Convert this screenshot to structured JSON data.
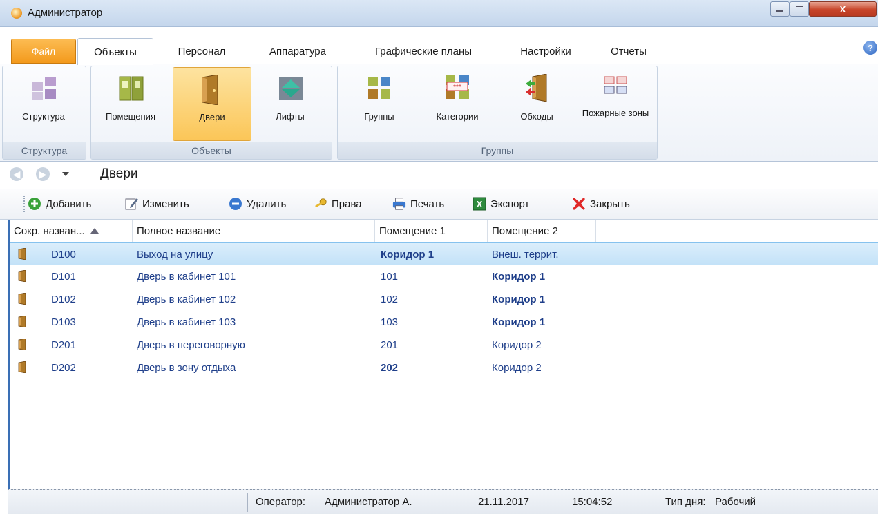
{
  "window": {
    "title": "Администратор",
    "controls": {
      "minimize": "_",
      "maximize": "□",
      "close": "X"
    }
  },
  "ribbon_tabs": {
    "file": "Файл",
    "tabs": [
      "Объекты",
      "Персонал",
      "Аппаратура",
      "Графические планы",
      "Настройки",
      "Отчеты"
    ],
    "active": "Объекты"
  },
  "ribbon": {
    "groups": [
      {
        "label": "Структура",
        "buttons": [
          {
            "label": "Структура",
            "icon": "structure-icon"
          }
        ]
      },
      {
        "label": "Объекты",
        "buttons": [
          {
            "label": "Помещения",
            "icon": "rooms-icon"
          },
          {
            "label": "Двери",
            "icon": "door-icon",
            "selected": true
          },
          {
            "label": "Лифты",
            "icon": "elevator-icon"
          }
        ]
      },
      {
        "label": "Группы",
        "buttons": [
          {
            "label": "Группы",
            "icon": "groups-icon"
          },
          {
            "label": "Категории",
            "icon": "categories-icon"
          },
          {
            "label": "Обходы",
            "icon": "rounds-icon"
          },
          {
            "label": "Пожарные зоны",
            "icon": "fire-zones-icon"
          }
        ]
      }
    ]
  },
  "nav": {
    "title": "Двери"
  },
  "toolbar": {
    "add": "Добавить",
    "edit": "Изменить",
    "delete": "Удалить",
    "rights": "Права",
    "print": "Печать",
    "export": "Экспорт",
    "close": "Закрыть"
  },
  "table": {
    "columns": [
      "Сокр. назван...",
      "Полное название",
      "Помещение 1",
      "Помещение 2"
    ],
    "sort_column": "Сокр. назван...",
    "rows": [
      {
        "short": "D100",
        "full": "Выход на улицу",
        "room1": "Коридор 1",
        "room1_bold": true,
        "room2": "Внеш. террит.",
        "room2_bold": false,
        "selected": true
      },
      {
        "short": "D101",
        "full": "Дверь в кабинет 101",
        "room1": "101",
        "room1_bold": false,
        "room2": "Коридор 1",
        "room2_bold": true,
        "selected": false
      },
      {
        "short": "D102",
        "full": "Дверь в кабинет 102",
        "room1": "102",
        "room1_bold": false,
        "room2": "Коридор 1",
        "room2_bold": true,
        "selected": false
      },
      {
        "short": "D103",
        "full": "Дверь в кабинет 103",
        "room1": "103",
        "room1_bold": false,
        "room2": "Коридор 1",
        "room2_bold": true,
        "selected": false
      },
      {
        "short": "D201",
        "full": "Дверь в переговорную",
        "room1": "201",
        "room1_bold": false,
        "room2": "Коридор 2",
        "room2_bold": false,
        "selected": false
      },
      {
        "short": "D202",
        "full": "Дверь в зону отдыха",
        "room1": "202",
        "room1_bold": true,
        "room2": "Коридор 2",
        "room2_bold": false,
        "selected": false
      }
    ]
  },
  "status": {
    "operator_label": "Оператор:",
    "operator": "Администратор А.",
    "date": "21.11.2017",
    "time": "15:04:52",
    "daytype_label": "Тип дня:",
    "daytype": "Рабочий"
  },
  "colors": {
    "accent": "#f39a1c",
    "selection": "#c3e2f8",
    "link_text": "#1f3f8a"
  }
}
